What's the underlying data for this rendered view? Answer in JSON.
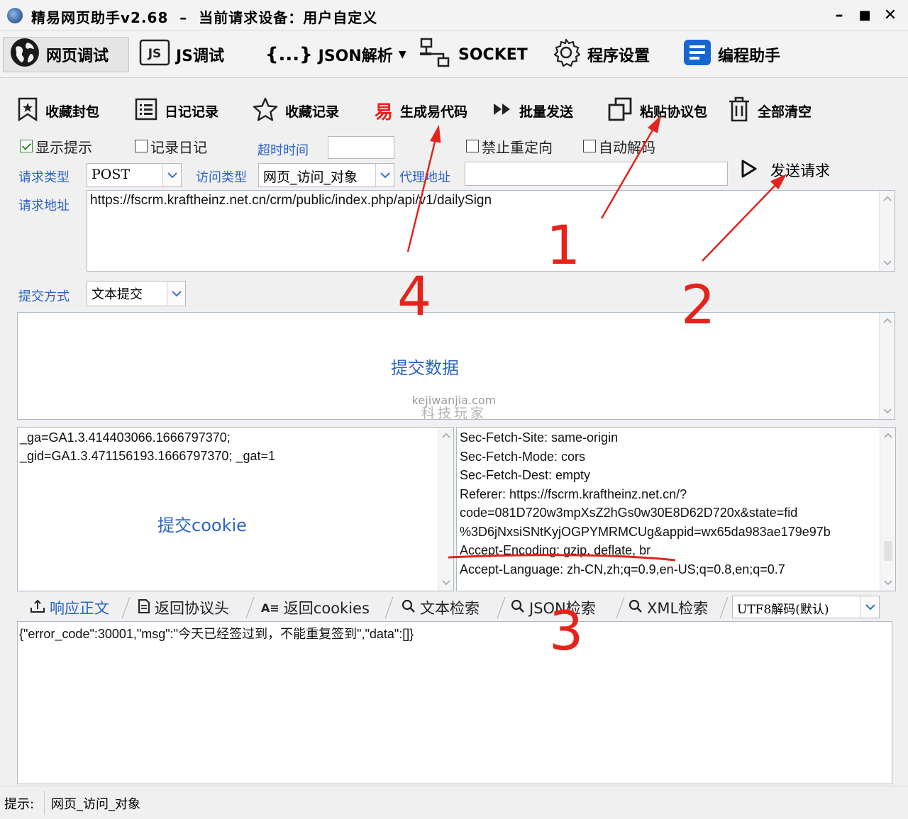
{
  "window": {
    "title": "精易网页助手v2.68  –  当前请求设备：用户自定义",
    "minimize": "–",
    "maximize": "■",
    "close": "✕"
  },
  "menu": {
    "items": [
      {
        "label": "网页调试",
        "icon": "globe-icon"
      },
      {
        "label": "JS调试",
        "icon": "js-icon"
      },
      {
        "label": "JSON解析",
        "icon": "braces-icon"
      },
      {
        "label": "SOCKET",
        "icon": "socket-icon"
      },
      {
        "label": "程序设置",
        "icon": "gear-icon"
      },
      {
        "label": "编程助手",
        "icon": "helper-icon"
      }
    ],
    "braces_glyph": "{...}"
  },
  "toolbar": {
    "save_packet": "收藏封包",
    "log_record": "日记记录",
    "favorites": "收藏记录",
    "gen_code": "生成易代码",
    "gen_code_glyph": "易",
    "batch_send": "批量发送",
    "paste_packet": "粘贴协议包",
    "clear_all": "全部清空"
  },
  "options": {
    "show_tips": {
      "label": "显示提示",
      "checked": true
    },
    "record_log": {
      "label": "记录日记",
      "checked": false
    },
    "timeout_label": "超时时间",
    "timeout_value": "",
    "no_redirect": {
      "label": "禁止重定向",
      "checked": false
    },
    "auto_decode": {
      "label": "自动解码",
      "checked": false
    }
  },
  "request": {
    "method_label": "请求类型",
    "method_value": "POST",
    "access_label": "访问类型",
    "access_value": "网页_访问_对象",
    "proxy_label": "代理地址",
    "proxy_value": "",
    "send_label": "发送请求",
    "url_label": "请求地址",
    "url_value": "https://fscrm.kraftheinz.net.cn/crm/public/index.php/api/v1/dailySign",
    "submit_label": "提交方式",
    "submit_value": "文本提交",
    "post_data_placeholder": "提交数据",
    "cookie_placeholder": "提交cookie",
    "cookie_lines": [
      "_ga=GA1.3.414403066.1666797370;",
      "_gid=GA1.3.471156193.1666797370; _gat=1"
    ],
    "header_lines": [
      "Sec-Fetch-Site: same-origin",
      "Sec-Fetch-Mode: cors",
      "Sec-Fetch-Dest: empty",
      "Referer: https://fscrm.kraftheinz.net.cn/?",
      "code=081D720w3mpXsZ2hGs0w30E8D62D720x&state=fid",
      "%3D6jNxsiSNtKyjOGPYMRMCUg&appid=wx65da983ae179e97b",
      "Accept-Encoding: gzip, deflate, br",
      "Accept-Language: zh-CN,zh;q=0.9,en-US;q=0.8,en;q=0.7"
    ]
  },
  "response": {
    "tabs": [
      {
        "label": "响应正文",
        "icon": "response-icon",
        "active": true
      },
      {
        "label": "返回协议头",
        "icon": "document-icon",
        "active": false
      },
      {
        "label": "返回cookies",
        "icon": "cookie-list-icon",
        "active": false
      },
      {
        "label": "文本检索",
        "icon": "search-icon",
        "active": false
      },
      {
        "label": "JSON检索",
        "icon": "search-icon",
        "active": false
      },
      {
        "label": "XML检索",
        "icon": "search-icon",
        "active": false
      }
    ],
    "encoding_value": "UTF8解码(默认)",
    "body": "{\"error_code\":30001,\"msg\":\"今天已经签过到，不能重复签到\",\"data\":[]}"
  },
  "status": {
    "label": "提示:",
    "value": "网页_访问_对象"
  },
  "annotations": {
    "n1": "1",
    "n2": "2",
    "n3": "3",
    "n4": "4",
    "color": "#e5231b"
  },
  "watermark": {
    "line1": "kejiwanjia.com",
    "line2": "科技玩家"
  }
}
